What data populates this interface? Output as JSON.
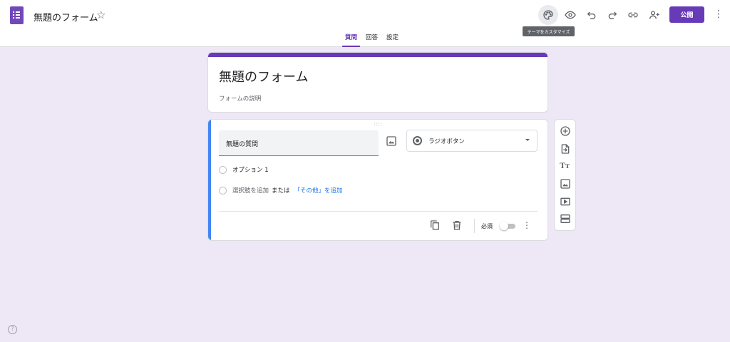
{
  "header": {
    "title": "無題のフォーム",
    "publish_label": "公開",
    "tooltip": "テーマをカスタマイズ",
    "accent_color": "#673ab7"
  },
  "icons": {
    "app": "forms-app-icon",
    "star": "star-outline-icon",
    "palette": "palette-icon",
    "preview": "eye-icon",
    "undo": "undo-icon",
    "redo": "redo-icon",
    "link": "link-icon",
    "add_collaborator": "person-add-icon",
    "more": "more-vert-icon"
  },
  "tabs": [
    {
      "label": "質問",
      "active": true
    },
    {
      "label": "回答",
      "active": false
    },
    {
      "label": "設定",
      "active": false
    }
  ],
  "form": {
    "title": "無題のフォーム",
    "description_placeholder": "フォームの説明"
  },
  "question": {
    "title": "無題の質問",
    "type": "ラジオボタン",
    "options": [
      "オプション 1"
    ],
    "add_option": "選択肢を追加",
    "or_text": "または",
    "add_other": "「その他」を追加",
    "required_label": "必須",
    "required": false,
    "accent_color": "#4285f4"
  },
  "side_toolbar": [
    "add-question-icon",
    "import-questions-icon",
    "add-title-icon",
    "add-image-icon",
    "add-video-icon",
    "add-section-icon"
  ]
}
